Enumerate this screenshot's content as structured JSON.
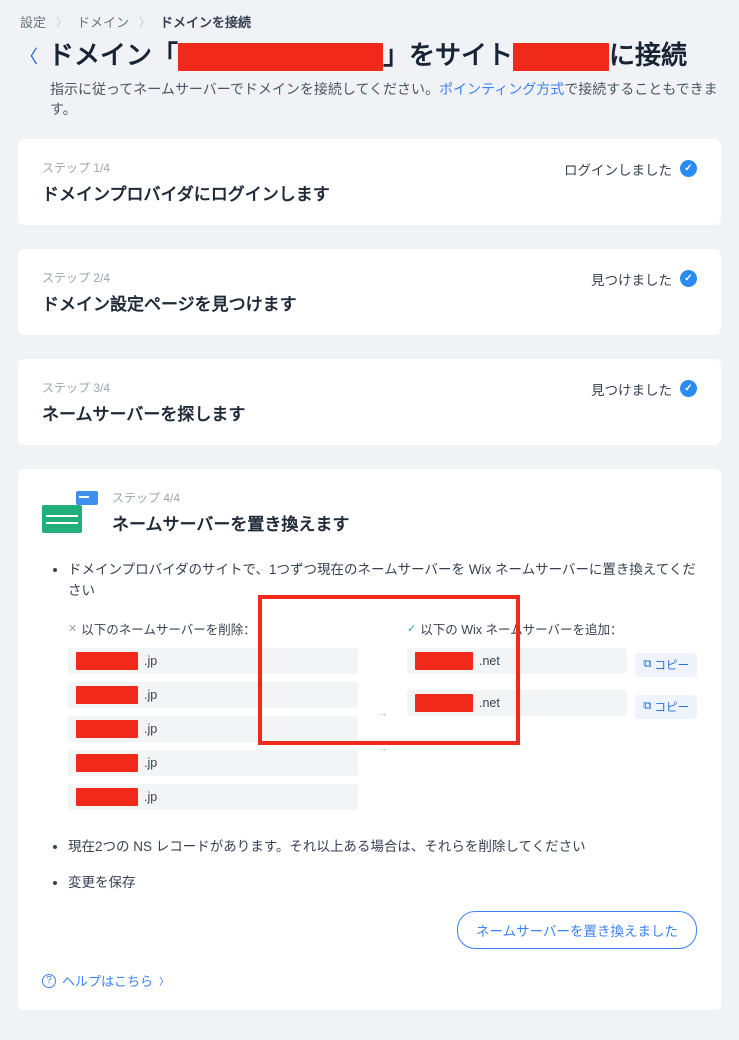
{
  "breadcrumb": {
    "a": "設定",
    "b": "ドメイン",
    "c": "ドメインを接続"
  },
  "title": {
    "pre": "ドメイン「",
    "mid": "」をサイト",
    "post": "に接続"
  },
  "subtitle": {
    "lead": "指示に従ってネームサーバーでドメインを接続してください。",
    "link": "ポインティング方式",
    "tail": "で接続することもできます。"
  },
  "steps": [
    {
      "tag": "ステップ 1/4",
      "title": "ドメインプロバイダにログインします",
      "status": "ログインしました"
    },
    {
      "tag": "ステップ 2/4",
      "title": "ドメイン設定ページを見つけます",
      "status": "見つけました"
    },
    {
      "tag": "ステップ 3/4",
      "title": "ネームサーバーを探します",
      "status": "見つけました"
    }
  ],
  "step4": {
    "tag": "ステップ 4/4",
    "title": "ネームサーバーを置き換えます",
    "bullet1": "ドメインプロバイダのサイトで、1つずつ現在のネームサーバーを Wix ネームサーバーに置き換えてください",
    "remove_label": "以下のネームサーバーを削除：",
    "add_label": "以下の Wix ネームサーバーを追加：",
    "remove_suffix": ".jp",
    "add_suffix": ".net",
    "copy": "コピー",
    "bullet2": "現在2つの NS レコードがあります。それ以上ある場合は、それらを削除してください",
    "bullet3": "変更を保存",
    "action": "ネームサーバーを置き換えました",
    "help": "ヘルプはこちら"
  }
}
